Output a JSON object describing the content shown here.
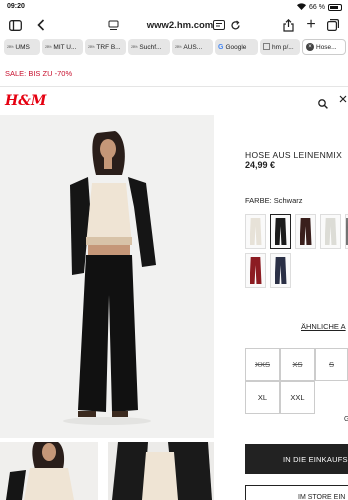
{
  "status": {
    "time": "09:20",
    "battery": "66 %"
  },
  "browser": {
    "url": "www2.hm.com",
    "tabs": [
      {
        "label": "UMS",
        "favicon": "28%"
      },
      {
        "label": "MIT U...",
        "favicon": "28%"
      },
      {
        "label": "TRF B...",
        "favicon": "28%"
      },
      {
        "label": "Suchf...",
        "favicon": "28%"
      },
      {
        "label": "AUS...",
        "favicon": "28%"
      },
      {
        "label": "Google",
        "favicon": "G"
      },
      {
        "label": "hm p/...",
        "favicon": ""
      },
      {
        "label": "Hose...",
        "favicon": "",
        "active": true
      }
    ]
  },
  "promo": {
    "text": "SALE: BIS ZU -70%"
  },
  "header": {
    "logo": "H&M"
  },
  "product": {
    "name": "HOSE AUS LEINENMIX",
    "price": "24,99 €",
    "color_label": "FARBE: Schwarz",
    "swatches": [
      {
        "color": "#e7e2d8",
        "selected": false
      },
      {
        "color": "#1b1b1b",
        "selected": true
      },
      {
        "color": "#3a1f1c",
        "selected": false
      },
      {
        "color": "#dcdcd6",
        "selected": false
      },
      {
        "color": "#5b5b5b",
        "selected": false
      },
      {
        "color": "#8c1c22",
        "selected": false
      },
      {
        "color": "#2a2f45",
        "selected": false
      }
    ],
    "similar_link": "ÄHNLICHE A",
    "sizes": [
      {
        "label": "XXS",
        "available": false
      },
      {
        "label": "XS",
        "available": false
      },
      {
        "label": "S",
        "available": false
      },
      {
        "label": "XL",
        "available": true
      },
      {
        "label": "XXL",
        "available": true
      }
    ],
    "size_guide_fragment": "G",
    "cart_button": "IN DIE EINKAUFS",
    "store_button": "IM STORE EIN"
  },
  "colors": {
    "brand_red": "#e50010",
    "sale_red": "#c8102e"
  }
}
